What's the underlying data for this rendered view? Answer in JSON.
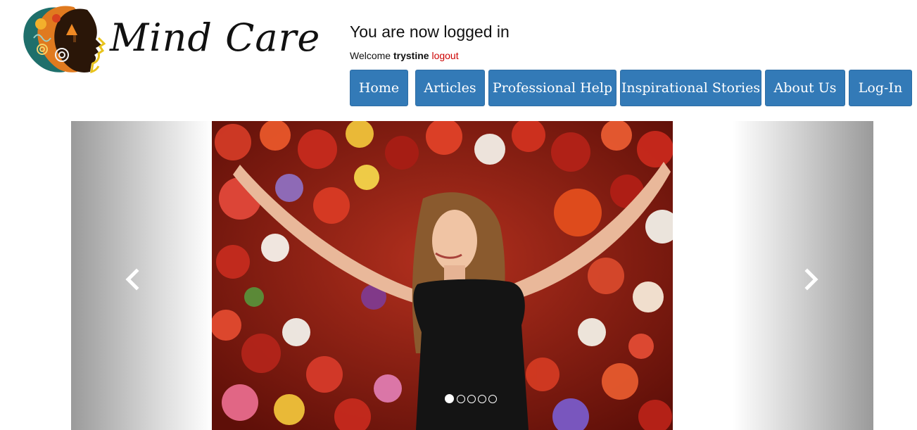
{
  "brand": {
    "name": "Mind Care",
    "logo_icon": "heads-silhouette-icon"
  },
  "status": {
    "title": "You are now logged in",
    "welcome_prefix": "Welcome",
    "username": "trystine",
    "logout_label": "logout",
    "logout_color": "#cc0000"
  },
  "nav": {
    "accent_color": "#337ab7",
    "items": [
      {
        "label": "Home"
      },
      {
        "label": "Articles"
      },
      {
        "label": "Professional Help"
      },
      {
        "label": "Inspirational Stories"
      },
      {
        "label": "About Us"
      },
      {
        "label": "Log-In"
      }
    ]
  },
  "carousel": {
    "slide_count": 5,
    "active_index": 0,
    "prev_icon": "chevron-left-icon",
    "next_icon": "chevron-right-icon"
  }
}
